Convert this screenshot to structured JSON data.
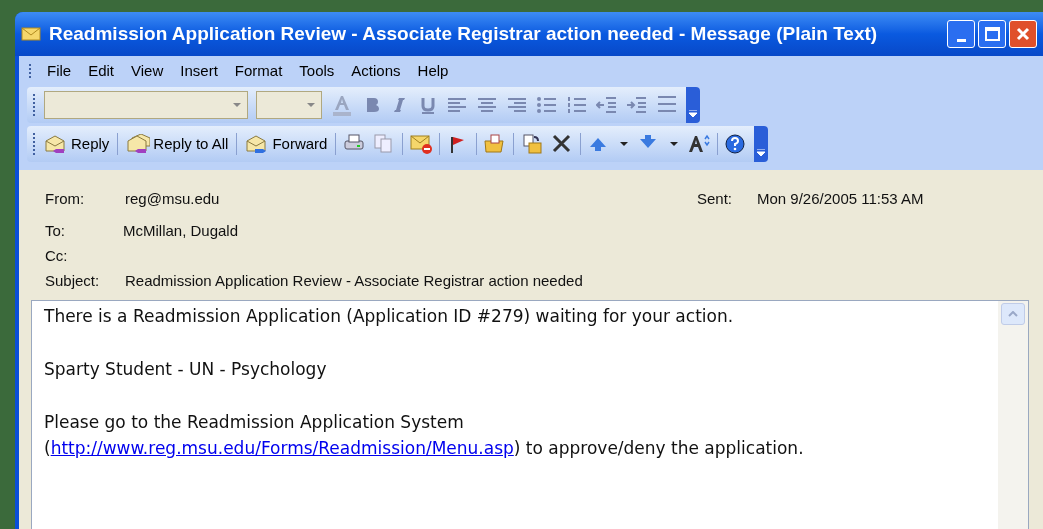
{
  "window": {
    "title": "Readmission Application Review - Associate Registrar action needed - Message (Plain Text)"
  },
  "menu": [
    "File",
    "Edit",
    "View",
    "Insert",
    "Format",
    "Tools",
    "Actions",
    "Help"
  ],
  "toolbar": {
    "buttons": [
      "Reply",
      "Reply to All",
      "Forward"
    ]
  },
  "header": {
    "from": {
      "label": "From:",
      "value": "reg@msu.edu"
    },
    "sent": {
      "label": "Sent:",
      "value": "Mon 9/26/2005 11:53 AM"
    },
    "to": {
      "label": "To:",
      "value": "McMillan, Dugald"
    },
    "cc": {
      "label": "Cc:"
    },
    "subject": {
      "label": "Subject:",
      "value": "Readmission Application Review - Associate Registrar action needed"
    }
  },
  "body": {
    "paragraphs": [
      {
        "lines": [
          {
            "text": "There is a Readmission Application (Application ID #279) waiting for your action."
          }
        ]
      },
      {
        "lines": [
          {
            "text": "Sparty Student - UN - Psychology"
          }
        ]
      },
      {
        "lines": [
          {
            "text": "Please go to the Readmission Application System"
          },
          {
            "before": "(",
            "link": "http://www.reg.msu.edu/Forms/Readmission/Menu.asp",
            "after": ") to approve/deny the application."
          }
        ]
      }
    ]
  }
}
